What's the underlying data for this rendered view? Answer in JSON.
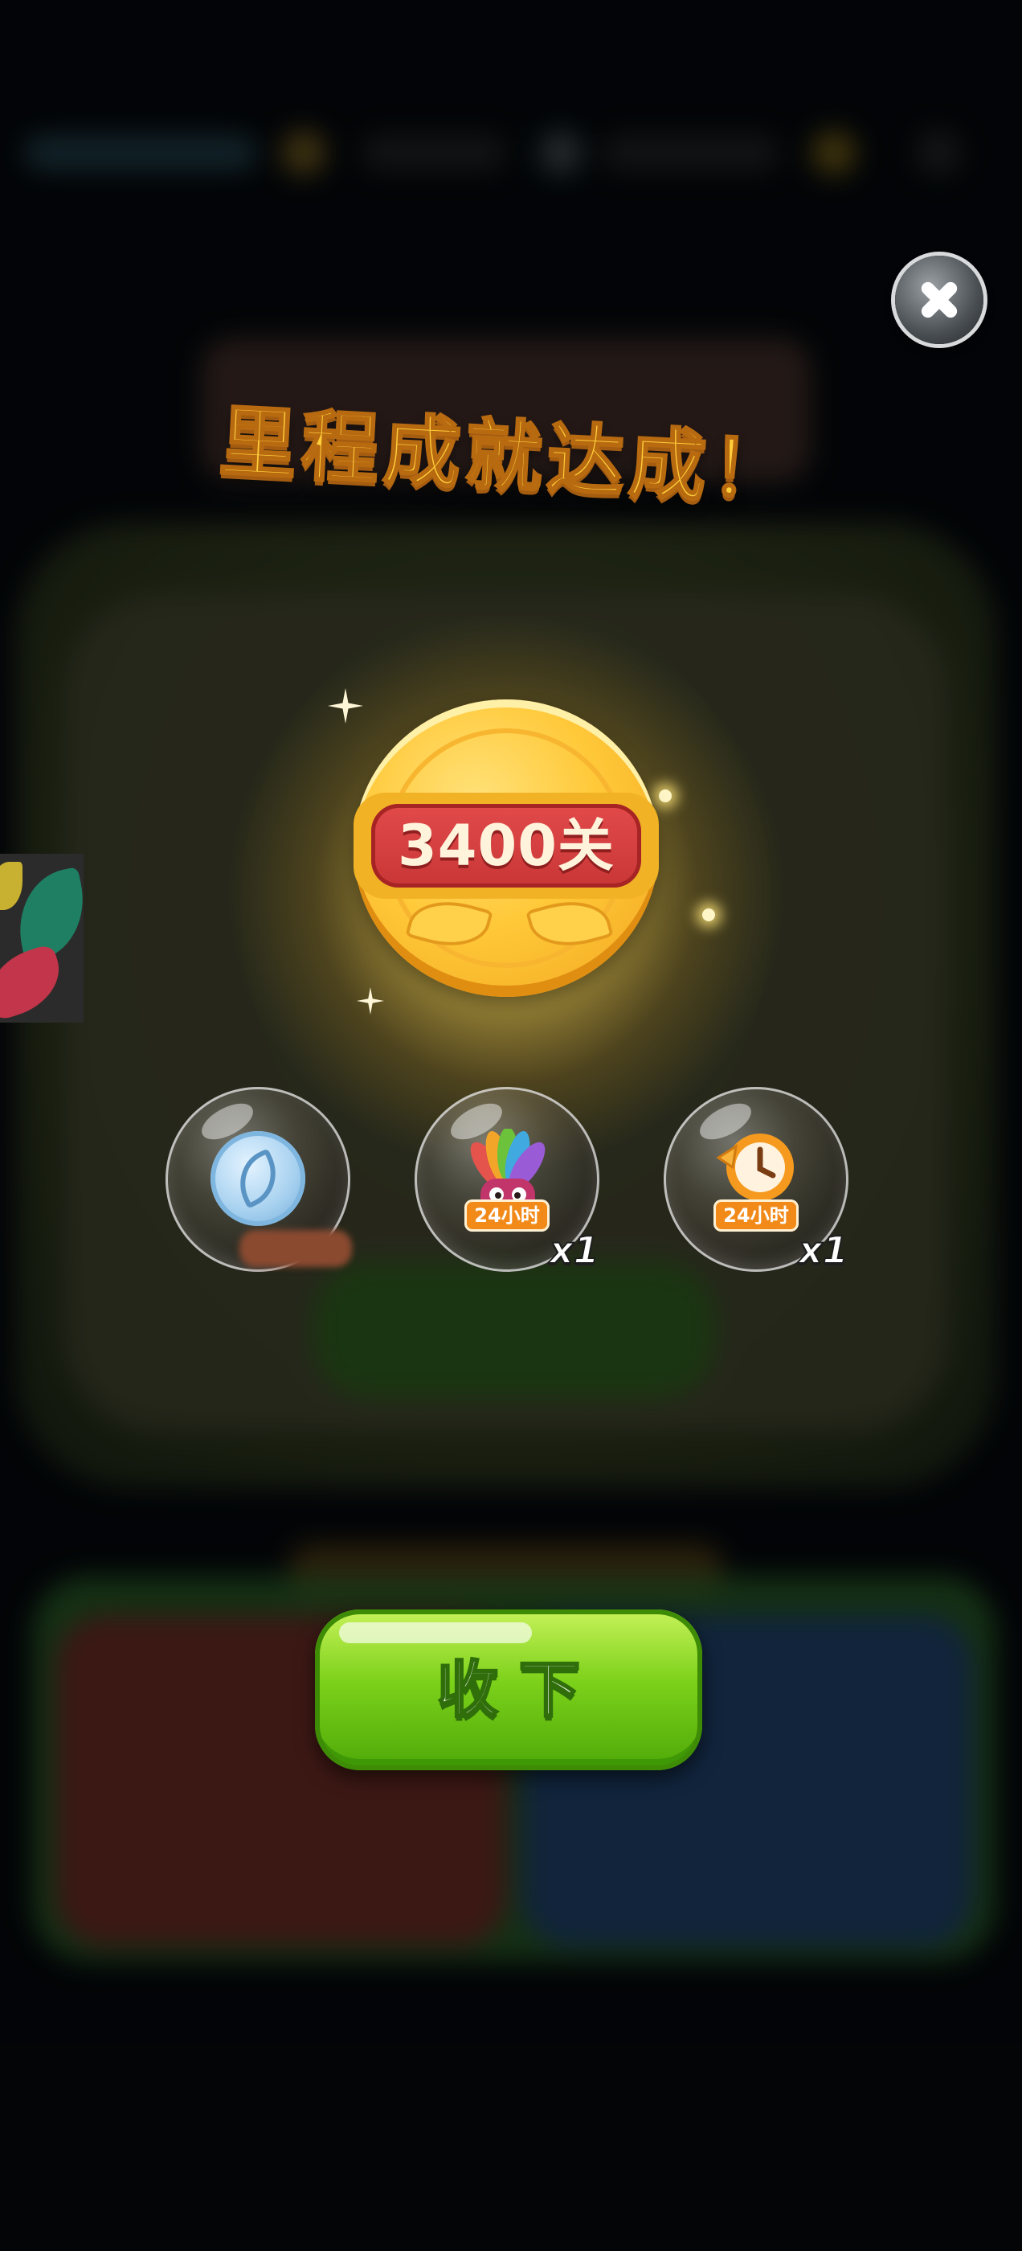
{
  "popup": {
    "title": "里程成就达成！",
    "medal_label": "3400关",
    "close_label": "close"
  },
  "rewards": [
    {
      "icon": "leaf-coin-icon",
      "quantity": ""
    },
    {
      "icon": "rainbow-feather-booster-icon",
      "badge": "24小时",
      "quantity": "x1"
    },
    {
      "icon": "clock-timer-booster-icon",
      "badge": "24小时",
      "quantity": "x1"
    }
  ],
  "collect_button": {
    "label": "收下"
  },
  "colors": {
    "title_gold": "#ffce3a",
    "medal_red": "#e24a4a",
    "button_green": "#7cd11a",
    "badge_orange": "#f28a1a"
  }
}
